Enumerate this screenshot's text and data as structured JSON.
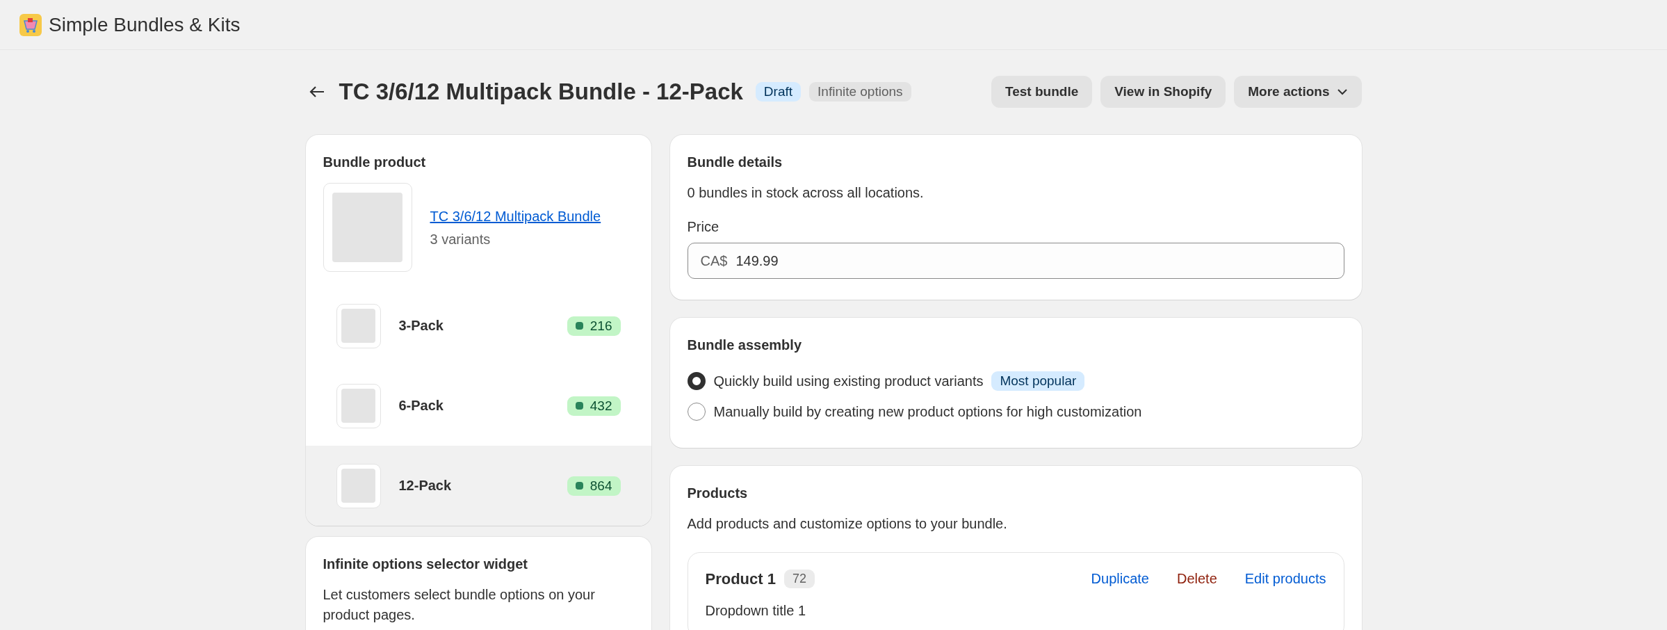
{
  "app": {
    "title": "Simple Bundles & Kits"
  },
  "page": {
    "title": "TC 3/6/12 Multipack Bundle - 12-Pack",
    "badges": [
      {
        "label": "Draft",
        "kind": "info"
      },
      {
        "label": "Infinite options",
        "kind": "neutral"
      }
    ],
    "actions": [
      {
        "label": "Test bundle",
        "kind": "plain"
      },
      {
        "label": "View in Shopify",
        "kind": "plain"
      },
      {
        "label": "More actions",
        "kind": "menu"
      }
    ]
  },
  "bundle_product": {
    "heading": "Bundle product",
    "product_link": "TC 3/6/12 Multipack Bundle",
    "variant_count": "3 variants",
    "variants": [
      {
        "name": "3-Pack",
        "stock": "216",
        "selected": false
      },
      {
        "name": "6-Pack",
        "stock": "432",
        "selected": false
      },
      {
        "name": "12-Pack",
        "stock": "864",
        "selected": true
      }
    ]
  },
  "widget": {
    "heading": "Infinite options selector widget",
    "description": "Let customers select bundle options on your product pages."
  },
  "bundle_details": {
    "heading": "Bundle details",
    "stock_note": "0 bundles in stock across all locations.",
    "price_label": "Price",
    "currency": "CA$",
    "price": "149.99"
  },
  "bundle_assembly": {
    "heading": "Bundle assembly",
    "options": [
      {
        "label": "Quickly build using existing product variants",
        "badge": "Most popular",
        "selected": true
      },
      {
        "label": "Manually build by creating new product options for high customization",
        "selected": false
      }
    ]
  },
  "products": {
    "heading": "Products",
    "description": "Add products and customize options to your bundle.",
    "items": [
      {
        "title": "Product 1",
        "count": "72",
        "actions": [
          {
            "label": "Duplicate",
            "kind": "link"
          },
          {
            "label": "Delete",
            "kind": "critical"
          },
          {
            "label": "Edit products",
            "kind": "link"
          }
        ],
        "dropdown_title": "Dropdown title 1"
      }
    ]
  }
}
